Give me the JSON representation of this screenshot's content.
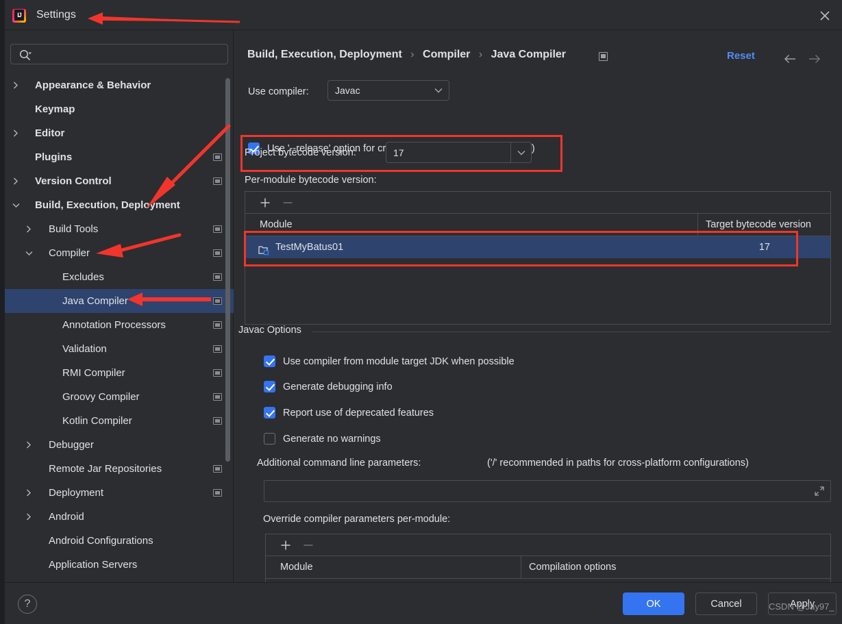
{
  "window": {
    "title": "Settings",
    "app_icon": "intellij-idea-logo",
    "close_icon": "close-icon"
  },
  "sidebar": {
    "search": {
      "placeholder": "",
      "value": "",
      "icon": "search-icon"
    },
    "items": [
      {
        "label": "Appearance & Behavior",
        "indent": 0,
        "chevron": "right",
        "bold": true,
        "badge": false,
        "selected": false
      },
      {
        "label": "Keymap",
        "indent": 0,
        "chevron": "none",
        "bold": true,
        "badge": false,
        "selected": false
      },
      {
        "label": "Editor",
        "indent": 0,
        "chevron": "right",
        "bold": true,
        "badge": false,
        "selected": false
      },
      {
        "label": "Plugins",
        "indent": 0,
        "chevron": "none",
        "bold": true,
        "badge": true,
        "selected": false
      },
      {
        "label": "Version Control",
        "indent": 0,
        "chevron": "right",
        "bold": true,
        "badge": true,
        "selected": false
      },
      {
        "label": "Build, Execution, Deployment",
        "indent": 0,
        "chevron": "down",
        "bold": true,
        "badge": false,
        "selected": false
      },
      {
        "label": "Build Tools",
        "indent": 1,
        "chevron": "right",
        "bold": false,
        "badge": true,
        "selected": false
      },
      {
        "label": "Compiler",
        "indent": 1,
        "chevron": "down",
        "bold": false,
        "badge": true,
        "selected": false
      },
      {
        "label": "Excludes",
        "indent": 2,
        "chevron": "none",
        "bold": false,
        "badge": true,
        "selected": false
      },
      {
        "label": "Java Compiler",
        "indent": 2,
        "chevron": "none",
        "bold": false,
        "badge": true,
        "selected": true
      },
      {
        "label": "Annotation Processors",
        "indent": 2,
        "chevron": "none",
        "bold": false,
        "badge": true,
        "selected": false
      },
      {
        "label": "Validation",
        "indent": 2,
        "chevron": "none",
        "bold": false,
        "badge": true,
        "selected": false
      },
      {
        "label": "RMI Compiler",
        "indent": 2,
        "chevron": "none",
        "bold": false,
        "badge": true,
        "selected": false
      },
      {
        "label": "Groovy Compiler",
        "indent": 2,
        "chevron": "none",
        "bold": false,
        "badge": true,
        "selected": false
      },
      {
        "label": "Kotlin Compiler",
        "indent": 2,
        "chevron": "none",
        "bold": false,
        "badge": true,
        "selected": false
      },
      {
        "label": "Debugger",
        "indent": 1,
        "chevron": "right",
        "bold": false,
        "badge": false,
        "selected": false
      },
      {
        "label": "Remote Jar Repositories",
        "indent": 1,
        "chevron": "none",
        "bold": false,
        "badge": true,
        "selected": false
      },
      {
        "label": "Deployment",
        "indent": 1,
        "chevron": "right",
        "bold": false,
        "badge": true,
        "selected": false
      },
      {
        "label": "Android",
        "indent": 1,
        "chevron": "right",
        "bold": false,
        "badge": false,
        "selected": false
      },
      {
        "label": "Android Configurations",
        "indent": 1,
        "chevron": "none",
        "bold": false,
        "badge": false,
        "selected": false
      },
      {
        "label": "Application Servers",
        "indent": 1,
        "chevron": "none",
        "bold": false,
        "badge": false,
        "selected": false
      }
    ]
  },
  "main": {
    "breadcrumb": {
      "part1": "Build, Execution, Deployment",
      "sep1": "›",
      "part2": "Compiler",
      "sep2": "›",
      "part3": "Java Compiler"
    },
    "reset_label": "Reset",
    "nav_back_icon": "arrow-left-icon",
    "nav_forward_icon": "arrow-right-icon",
    "use_compiler_label": "Use compiler:",
    "use_compiler_value": "Javac",
    "release_option_label": "Use '--release' option for cross-compilation (Java 9 and later)",
    "release_option_checked": true,
    "project_bytecode_label": "Project bytecode version:",
    "project_bytecode_value": "17",
    "per_module_label": "Per-module bytecode version:",
    "modules_table": {
      "add_icon": "plus-icon",
      "remove_icon": "minus-icon",
      "columns": [
        "Module",
        "Target bytecode version"
      ],
      "rows": [
        {
          "module": "TestMyBatus01",
          "target": "17",
          "icon": "module-folder-icon",
          "selected": true
        }
      ]
    },
    "javac_group_title": "Javac Options",
    "javac_options": [
      {
        "label": "Use compiler from module target JDK when possible",
        "checked": true
      },
      {
        "label": "Generate debugging info",
        "checked": true
      },
      {
        "label": "Report use of deprecated features",
        "checked": true
      },
      {
        "label": "Generate no warnings",
        "checked": false
      }
    ],
    "additional_params_label": "Additional command line parameters:",
    "additional_params_hint": "('/' recommended in paths for cross-platform configurations)",
    "additional_params_value": "",
    "expand_icon": "expand-icon",
    "override_label": "Override compiler parameters per-module:",
    "override_table": {
      "add_icon": "plus-icon",
      "remove_icon": "minus-icon",
      "columns": [
        "Module",
        "Compilation options"
      ],
      "rows": []
    }
  },
  "footer": {
    "help_label": "?",
    "ok_label": "OK",
    "cancel_label": "Cancel",
    "apply_label": "Apply"
  },
  "watermark": "CSDN @Jay97_",
  "annotations": {
    "accent_color": "#f2352c",
    "arrows": [
      {
        "name": "arrow-to-settings-title"
      },
      {
        "name": "arrow-to-build-execution-deployment"
      },
      {
        "name": "arrow-to-compiler"
      },
      {
        "name": "arrow-to-java-compiler"
      }
    ],
    "boxes": [
      {
        "name": "highlight-project-bytecode-version"
      },
      {
        "name": "highlight-module-row"
      }
    ]
  },
  "colors": {
    "background": "#2b2d30",
    "selection": "#2e436e",
    "accent_blue": "#3574f0",
    "link_blue": "#548af7",
    "text": "#dfe1e5",
    "border": "#4a4d52"
  }
}
